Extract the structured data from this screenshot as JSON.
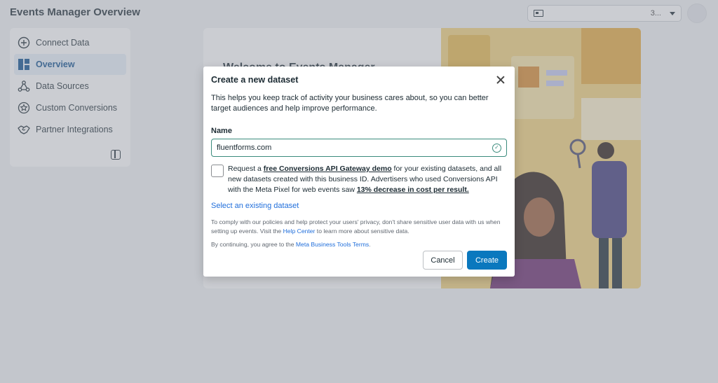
{
  "header": {
    "title": "Events Manager Overview",
    "account_name": "3..."
  },
  "sidebar": {
    "items": [
      {
        "label": "Connect Data",
        "icon": "plus-circle-icon"
      },
      {
        "label": "Overview",
        "icon": "grid-icon",
        "active": true
      },
      {
        "label": "Data Sources",
        "icon": "nodes-icon"
      },
      {
        "label": "Custom Conversions",
        "icon": "star-badge-icon"
      },
      {
        "label": "Partner Integrations",
        "icon": "handshake-icon"
      }
    ]
  },
  "main": {
    "welcome": "Welcome to Events Manager"
  },
  "modal": {
    "title": "Create a new dataset",
    "description": "This helps you keep track of activity your business cares about, so you can better target audiences and help improve performance.",
    "name_label": "Name",
    "name_value": "fluentforms.com",
    "optin_prefix": "Request a ",
    "optin_link": "free Conversions API Gateway demo",
    "optin_middle": " for your existing datasets, and all new datasets created with this business ID. Advertisers who used Conversions API with the Meta Pixel for web events saw ",
    "optin_stat": "13% decrease in cost per result.",
    "select_existing": "Select an existing dataset",
    "policy_prefix": "To comply with our policies and help protect your users' privacy, don't share sensitive user data with us when setting up events. Visit the ",
    "policy_link": "Help Center",
    "policy_suffix": " to learn more about sensitive data.",
    "terms_prefix": "By continuing, you agree to the ",
    "terms_link": "Meta Business Tools Terms",
    "terms_suffix": ".",
    "cancel_label": "Cancel",
    "create_label": "Create"
  },
  "colors": {
    "primary": "#0a78be",
    "link": "#216fdb",
    "valid": "#3b8b7d",
    "active_nav": "#e7f0fa"
  }
}
